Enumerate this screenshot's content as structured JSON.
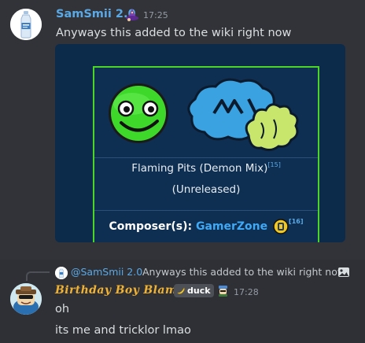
{
  "message1": {
    "username": "SamSmii 2.0",
    "timestamp": "17:25",
    "content": "Anyways this added to the wiki right now",
    "avatar_icon": "water-bottle-icon",
    "role_icon": "wizard-hat-icon",
    "embed": {
      "song_title": "Flaming Pits (Demon Mix)",
      "song_title_ref": "[15]",
      "song_status": "(Unreleased)",
      "composer_label": "Composer(s):",
      "composer_name": "GamerZone",
      "composer_ref": "[16]",
      "border_color": "#4cd426",
      "background_color": "#0c2a4a"
    }
  },
  "message2": {
    "reply": {
      "username": "@SamSmii 2.0",
      "content": "Anyways this added to the wiki right now",
      "attachment_icon": "image-icon"
    },
    "username": "Birthday Boy Blam",
    "tag": "duck",
    "timestamp": "17:28",
    "lines": [
      "oh",
      "its me and tricklor lmao"
    ],
    "username_color": "#f0b232"
  },
  "colors": {
    "background": "#313338",
    "highlight_background": "#2e3035",
    "username_blue": "#5aa9e6",
    "link_blue": "#3fa9f5",
    "muted_text": "#949ba4"
  }
}
